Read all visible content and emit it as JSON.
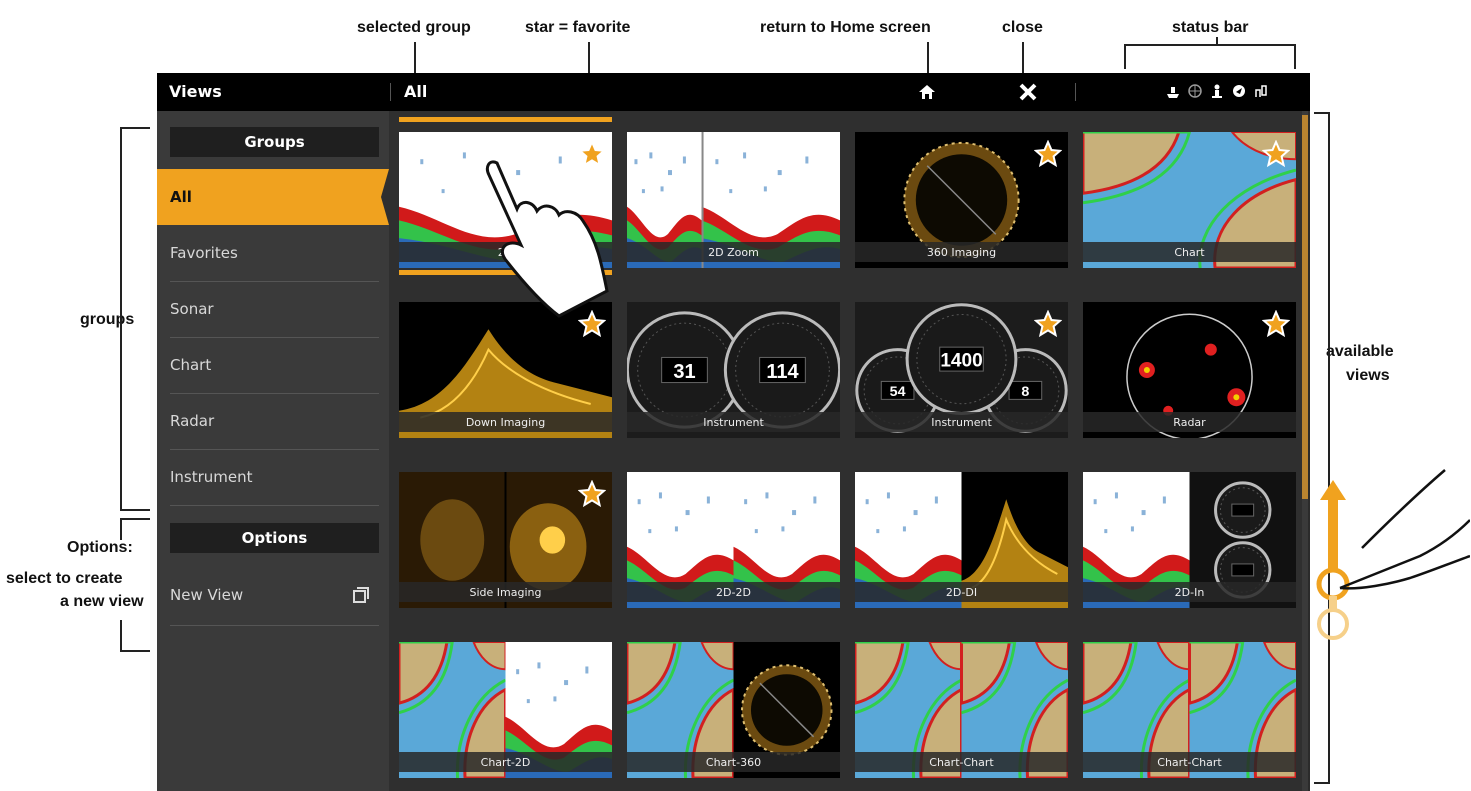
{
  "callouts": {
    "selected_group": "selected group",
    "star_favorite": "star = favorite",
    "return_home": "return to Home screen",
    "close": "close",
    "status_bar": "status bar",
    "groups": "groups",
    "available_views_1": "available",
    "available_views_2": "views",
    "options_1": "Options:",
    "options_2": "select to create",
    "options_3": "a new view"
  },
  "topbar": {
    "title": "Views",
    "selected_group": "All",
    "home_icon": "home-icon",
    "close_icon": "close-icon",
    "status_icons": [
      "boat-icon",
      "wheel-icon",
      "anchor-icon",
      "navigation-icon",
      "network-icon"
    ]
  },
  "sidebar": {
    "groups_header": "Groups",
    "items": [
      {
        "label": "All",
        "selected": true
      },
      {
        "label": "Favorites",
        "selected": false
      },
      {
        "label": "Sonar",
        "selected": false
      },
      {
        "label": "Chart",
        "selected": false
      },
      {
        "label": "Radar",
        "selected": false
      },
      {
        "label": "Instrument",
        "selected": false
      }
    ],
    "options_header": "Options",
    "new_view_label": "New View",
    "new_view_icon": "new-view-icon"
  },
  "views": [
    {
      "label": "2D",
      "type": "sonar2d",
      "favorite": true,
      "selected": true
    },
    {
      "label": "2D Zoom",
      "type": "sonar2dzoom",
      "favorite": false
    },
    {
      "label": "360 Imaging",
      "type": "imaging360",
      "favorite": true
    },
    {
      "label": "Chart",
      "type": "chart",
      "favorite": true
    },
    {
      "label": "Down Imaging",
      "type": "downimaging",
      "favorite": true
    },
    {
      "label": "Instrument",
      "type": "instrument2",
      "favorite": false
    },
    {
      "label": "Instrument",
      "type": "instrument3",
      "favorite": true
    },
    {
      "label": "Radar",
      "type": "radar",
      "favorite": true
    },
    {
      "label": "Side Imaging",
      "type": "sideimaging",
      "favorite": true
    },
    {
      "label": "2D-2D",
      "type": "split-2d-2d",
      "favorite": false
    },
    {
      "label": "2D-DI",
      "type": "split-2d-di",
      "favorite": false
    },
    {
      "label": "2D-In",
      "type": "split-2d-in",
      "favorite": false
    },
    {
      "label": "Chart-2D",
      "type": "split-chart-2d",
      "favorite": false
    },
    {
      "label": "Chart-360",
      "type": "split-chart-360",
      "favorite": false
    },
    {
      "label": "Chart-Chart",
      "type": "split-chart-chart",
      "favorite": false
    },
    {
      "label": "Chart-Chart",
      "type": "split-chart-chart",
      "favorite": false
    }
  ],
  "values": {
    "instrument2_left": "31",
    "instrument2_right": "114",
    "instrument3_center": "1400",
    "instrument3_left": "54",
    "instrument3_right": "8"
  },
  "colors": {
    "accent": "#f0a21f",
    "chart_water": "#5aa8d8",
    "chart_land": "#c8b07a",
    "contour_red": "#d22020",
    "contour_green": "#2fd04a"
  }
}
